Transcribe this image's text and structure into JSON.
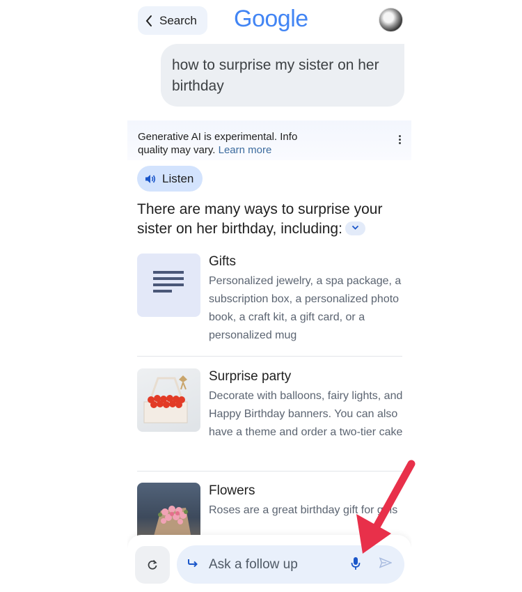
{
  "header": {
    "back_label": "Search",
    "logo_letters": [
      {
        "char": "G",
        "color": "#4285F4"
      },
      {
        "char": "o",
        "color": "#4285F4"
      },
      {
        "char": "o",
        "color": "#4285F4"
      },
      {
        "char": "g",
        "color": "#4285F4"
      },
      {
        "char": "l",
        "color": "#4285F4"
      },
      {
        "char": "e",
        "color": "#4285F4"
      }
    ]
  },
  "query": "how to surprise my sister on her birthday",
  "disclaimer": {
    "text": "Generative AI is experimental. Info quality may vary.",
    "link": "Learn more"
  },
  "listen_label": "Listen",
  "heading": "There are many ways to surprise your sister on her birthday, including:",
  "items": [
    {
      "title": "Gifts",
      "description": "Personalized jewelry, a spa package, a subscription box, a personalized photo book, a craft kit, a gift card, or a personalized mug",
      "thumb": "document-icon"
    },
    {
      "title": "Surprise party",
      "description": "Decorate with balloons, fairy lights, and Happy Birthday banners. You can also have a theme and order a two-tier cake",
      "thumb": "rose-box-image"
    },
    {
      "title": "Flowers",
      "description": "Roses are a great birthday gift for girls",
      "thumb": "flower-bouquet-image"
    }
  ],
  "followup": {
    "placeholder": "Ask a follow up"
  },
  "colors": {
    "accent_blue": "#1a56c9",
    "annotation_arrow": "#e8304a"
  }
}
